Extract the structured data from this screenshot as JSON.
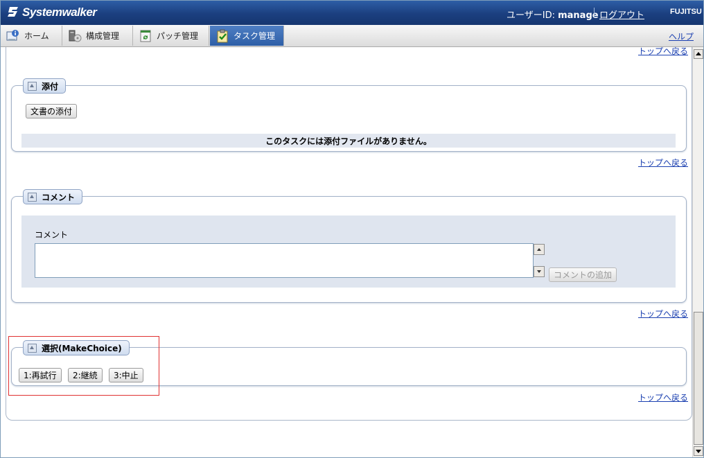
{
  "header": {
    "logo": "Systemwalker",
    "user_prefix": "ユーザーID: ",
    "user_id": "manage",
    "logout": "ログアウト",
    "brand": "FUJITSU"
  },
  "tabs": [
    {
      "label": "ホーム",
      "icon": "home-info-icon"
    },
    {
      "label": "構成管理",
      "icon": "configuration-icon"
    },
    {
      "label": "パッチ管理",
      "icon": "patch-icon"
    },
    {
      "label": "タスク管理",
      "icon": "task-checklist-icon",
      "active": true
    }
  ],
  "help": "ヘルプ",
  "top_link": "トップへ戻る",
  "attach": {
    "title": "添付",
    "add_button": "文書の添付",
    "empty_message": "このタスクには添付ファイルがありません。"
  },
  "comment": {
    "title": "コメント",
    "field_label": "コメント",
    "value": "",
    "add_button": "コメントの追加"
  },
  "choice": {
    "title": "選択(MakeChoice)",
    "buttons": [
      "1:再試行",
      "2:継続",
      "3:中止"
    ]
  },
  "colors": {
    "header": "#1b3f7f",
    "active_tab": "#2d5ea7",
    "highlight": "#e03030"
  }
}
